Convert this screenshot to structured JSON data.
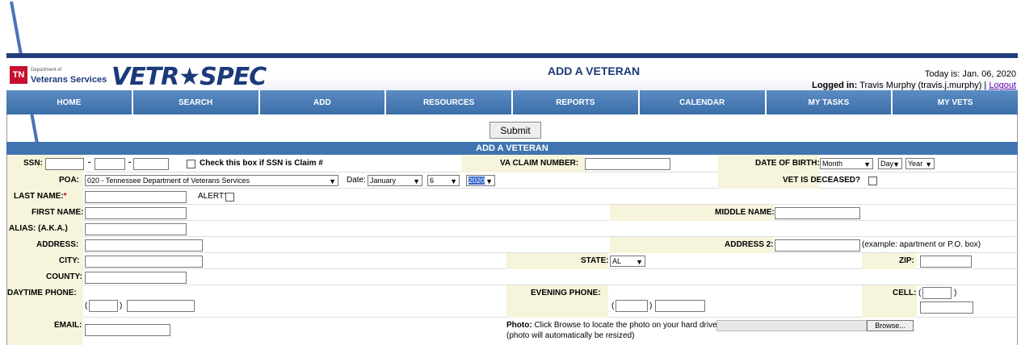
{
  "header": {
    "dept_small": "Department of",
    "dept_name": "Veterans Services",
    "tn_badge": "TN",
    "logo_text": "VETR★SPEC",
    "page_heading": "ADD A VETERAN",
    "today": "Today is: Jan. 06, 2020",
    "logged_in_label": "Logged in:",
    "logged_in_user": "Travis Murphy (travis.j.murphy)",
    "separator": "|",
    "logout": "Logout"
  },
  "nav": [
    "HOME",
    "SEARCH",
    "ADD",
    "RESOURCES",
    "REPORTS",
    "CALENDAR",
    "MY TASKS",
    "MY VETS"
  ],
  "submit_label": "Submit",
  "section_title": "ADD A VETERAN",
  "form": {
    "ssn_label": "SSN:",
    "ssn_dash": "-",
    "ssn_claim_checkbox_label": "Check this box if SSN is Claim #",
    "va_claim_label": "VA CLAIM NUMBER:",
    "dob_label": "DATE OF BIRTH:",
    "dob_month": "Month",
    "dob_day": "Day",
    "dob_year": "Year",
    "poa_label": "POA:",
    "poa_value": "020 - Tennessee Department of Veterans Services",
    "date_label": "Date:",
    "date_month": "January",
    "date_day": "6",
    "date_year": "2020",
    "vet_deceased_label": "VET IS DECEASED?",
    "last_name_label": "LAST NAME:",
    "required_star": "*",
    "alert_label": "ALERT?",
    "first_name_label": "FIRST NAME:",
    "middle_name_label": "MIDDLE NAME:",
    "alias_label": "ALIAS: (A.K.A.)",
    "address_label": "ADDRESS:",
    "address2_label": "ADDRESS 2:",
    "address2_hint": "(example: apartment or P.O. box)",
    "city_label": "CITY:",
    "state_label": "STATE:",
    "state_value": "AL",
    "zip_label": "ZIP:",
    "county_label": "COUNTY:",
    "daytime_phone_label": "DAYTIME PHONE:",
    "evening_phone_label": "EVENING PHONE:",
    "cell_label": "CELL:",
    "paren_open": "(",
    "paren_close": ")",
    "email_label": "EMAIL:",
    "photo_label": "Photo:",
    "photo_text": "Click Browse to locate the photo on your hard drive.",
    "photo_note": "(photo will automatically be resized)",
    "browse_label": "Browse..."
  }
}
